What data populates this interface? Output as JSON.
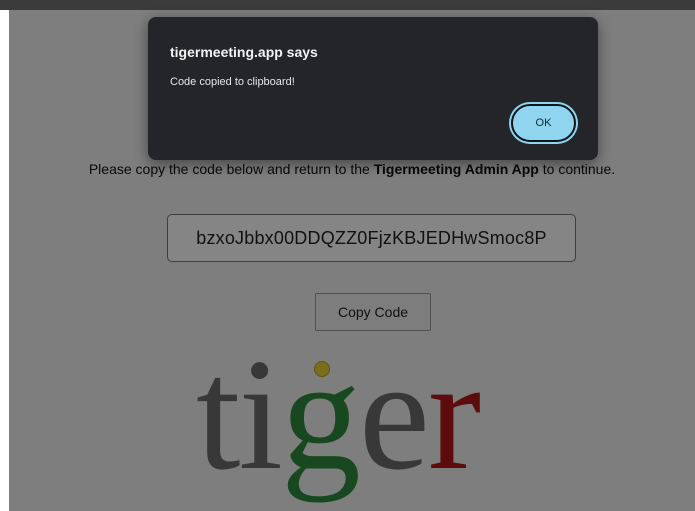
{
  "page": {
    "instruction_pre": "Please copy the code below and return to the ",
    "instruction_bold": "Tigermeeting Admin App",
    "instruction_post": " to continue.",
    "code": "bzxoJbbx00DDQZZ0FjzKBJEDHwSmoc8P",
    "copy_button_label": "Copy Code",
    "logo": {
      "letters": [
        "t",
        "i",
        "g",
        "e",
        "r"
      ],
      "colors": {
        "t": "#6b6b6b",
        "i": "#6b6b6b",
        "g": "#2e8b3e",
        "e": "#6b6b6b",
        "r": "#b01818",
        "dot": "#e8d23a"
      }
    }
  },
  "dialog": {
    "title": "tigermeeting.app says",
    "message": "Code copied to clipboard!",
    "ok_label": "OK",
    "accent": "#8fd5ef"
  }
}
